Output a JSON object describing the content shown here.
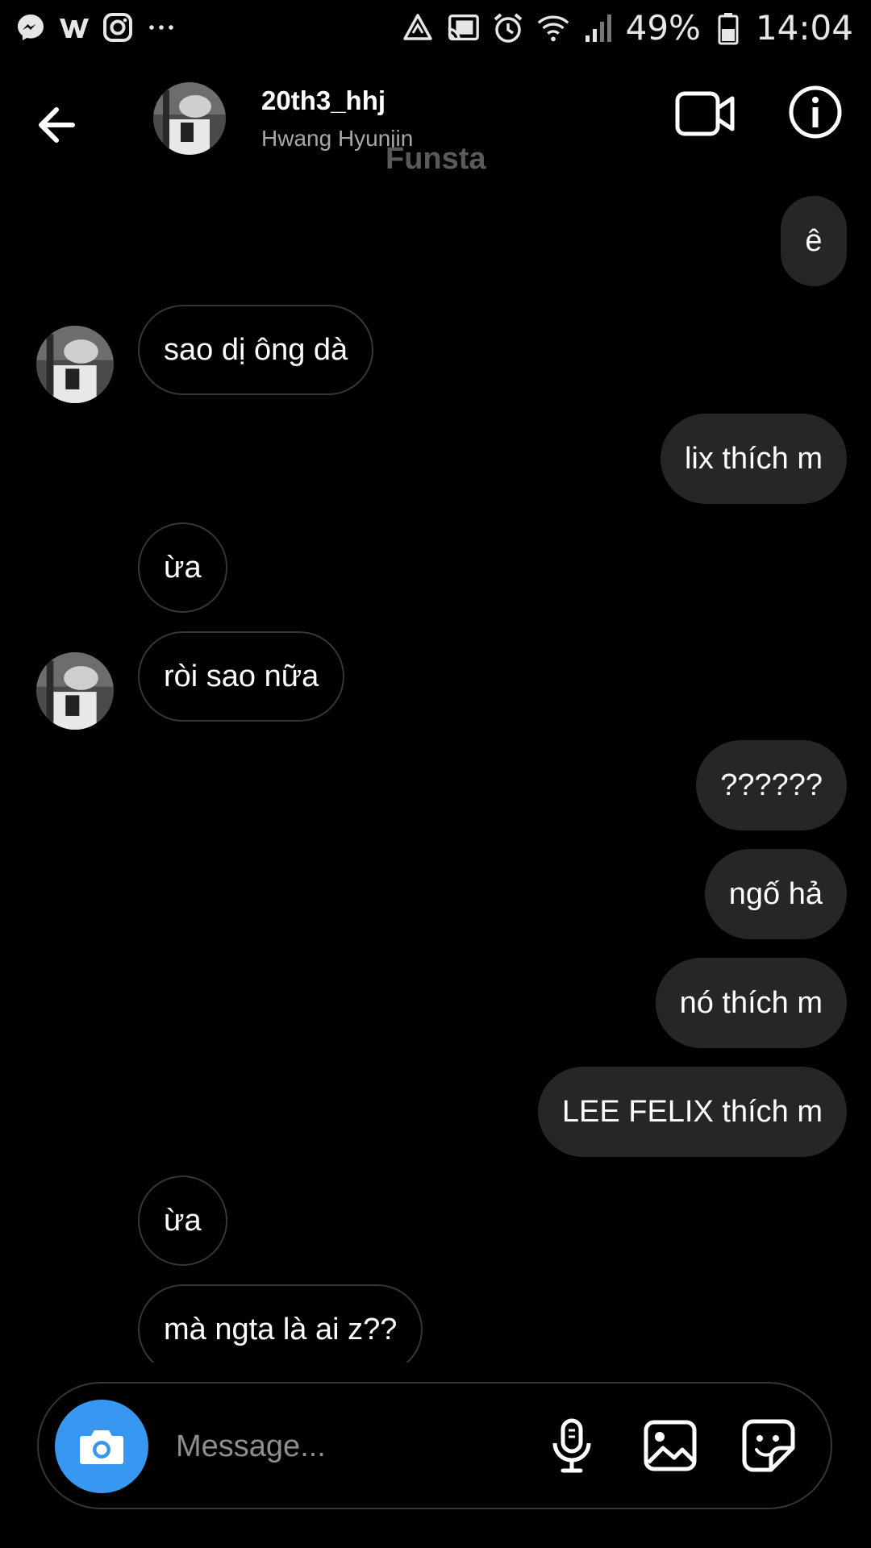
{
  "status_bar": {
    "battery": "49%",
    "time": "14:04",
    "left_icons": [
      "messenger-icon",
      "w-app-icon",
      "instagram-icon",
      "more-dots-icon"
    ],
    "right_icons": [
      "recycle-icon",
      "cast-icon",
      "alarm-icon",
      "wifi-icon",
      "signal-icon",
      "battery-icon"
    ]
  },
  "header": {
    "username": "20th3_hhj",
    "display_name": "Hwang Hyunjin",
    "watermark": "Funsta"
  },
  "messages": [
    {
      "side": "out",
      "text": "ê"
    },
    {
      "side": "in",
      "text": "sao dị ông dà",
      "avatar": true
    },
    {
      "side": "out",
      "text": "lix thích m"
    },
    {
      "side": "in",
      "text": "ừa",
      "avatar": false
    },
    {
      "side": "in",
      "text": "ròi sao nữa",
      "avatar": true
    },
    {
      "side": "out",
      "text": "??????"
    },
    {
      "side": "out",
      "text": "ngố hả"
    },
    {
      "side": "out",
      "text": "nó thích m"
    },
    {
      "side": "out",
      "text": "LEE FELIX thích m"
    },
    {
      "side": "in",
      "text": "ừa",
      "avatar": false
    },
    {
      "side": "in",
      "text": "mà ngta là ai z??",
      "avatar": false
    }
  ],
  "composer": {
    "placeholder": "Message..."
  },
  "colors": {
    "background": "#000000",
    "outgoing_bubble": "#262626",
    "incoming_border": "#363636",
    "camera_button": "#3897f0",
    "secondary_text": "#a8a8a8"
  }
}
